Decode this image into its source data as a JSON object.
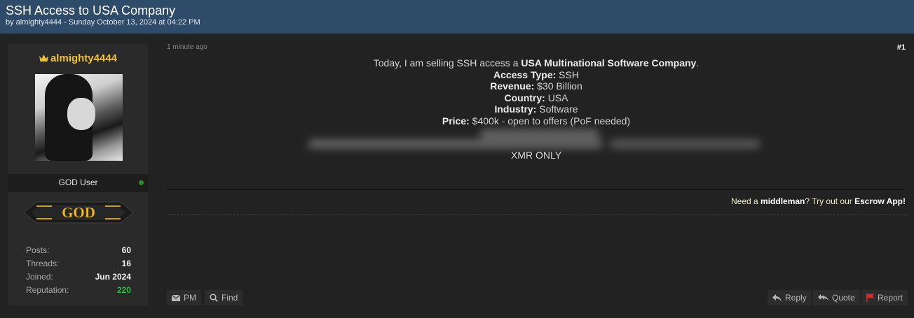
{
  "thread": {
    "title": "SSH Access to USA Company",
    "meta": "by almighty4444 - Sunday October 13, 2024 at 04:22 PM"
  },
  "author": {
    "username": "almighty4444",
    "rank": "GOD User",
    "badge_text": "GOD",
    "stats": [
      {
        "label": "Posts:",
        "value": "60"
      },
      {
        "label": "Threads:",
        "value": "16"
      },
      {
        "label": "Joined:",
        "value": "Jun 2024"
      },
      {
        "label": "Reputation:",
        "value": "220"
      }
    ]
  },
  "post": {
    "time": "1 minute ago",
    "number": "#1",
    "intro": "Today, I am selling SSH access a ",
    "company": "USA Multinational Software Company",
    "intro_end": ".",
    "fields": [
      {
        "label": "Access Type:",
        "value": " SSH"
      },
      {
        "label": "Revenue:",
        "value": " $30 Billion"
      },
      {
        "label": "Country:",
        "value": " USA"
      },
      {
        "label": "Industry:",
        "value": " Software"
      },
      {
        "label": "Price:",
        "value": " $400k - open to offers (PoF needed)"
      }
    ],
    "xmr": "XMR ONLY"
  },
  "escrow": {
    "pre": "Need a ",
    "middleman": "middleman",
    "mid": "? Try out our ",
    "app": "Escrow App!"
  },
  "actions": {
    "pm": "PM",
    "find": "Find",
    "reply": "Reply",
    "quote": "Quote",
    "report": "Report"
  },
  "colors": {
    "header_bg": "#2e4b6a",
    "page_bg": "#222222",
    "username": "#f2c12e",
    "reputation": "#2fbf3c",
    "report_flag": "#d42a2a"
  }
}
